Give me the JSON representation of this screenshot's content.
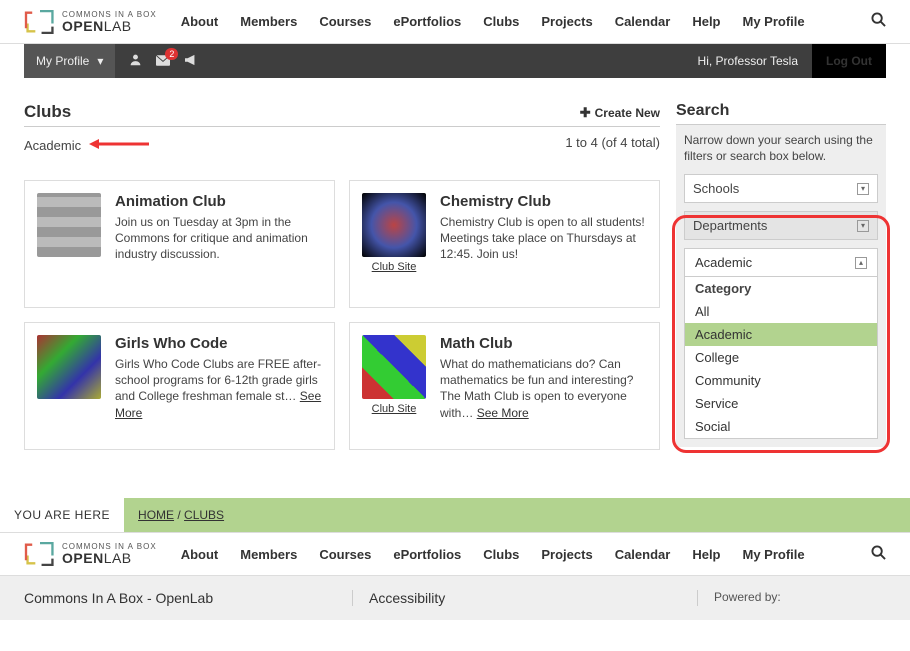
{
  "logo": {
    "line1": "COMMONS IN A BOX",
    "line2_bold": "OPEN",
    "line2_thin": "LAB"
  },
  "nav": [
    "About",
    "Members",
    "Courses",
    "ePortfolios",
    "Clubs",
    "Projects",
    "Calendar",
    "Help",
    "My Profile"
  ],
  "darkbar": {
    "my_profile": "My Profile",
    "notification_count": "2",
    "greeting": "Hi, Professor Tesla",
    "logout": "Log Out"
  },
  "page": {
    "title": "Clubs",
    "create_new": "Create New",
    "filter_label": "Academic",
    "count_text": "1 to 4 (of 4 total)"
  },
  "clubs": [
    {
      "title": "Animation Club",
      "desc": "Join us on Tuesday at 3pm in the Commons for critique and animation industry discussion.",
      "site": ""
    },
    {
      "title": "Chemistry Club",
      "desc": "Chemistry Club is open to all students! Meetings take place on Thursdays at 12:45. Join us!",
      "site": "Club Site"
    },
    {
      "title": "Girls Who Code",
      "desc": "Girls Who Code Clubs are FREE after-school programs for 6-12th grade girls and College freshman female st…",
      "seemore": "See More",
      "site": ""
    },
    {
      "title": "Math Club",
      "desc": "What do mathematicians do? Can mathematics be fun and interesting? The Math Club is open to everyone with…",
      "seemore": "See More",
      "site": "Club Site"
    }
  ],
  "search": {
    "heading": "Search",
    "help": "Narrow down your search using the filters or search box below.",
    "facets": [
      {
        "label": "Schools"
      },
      {
        "label": "Departments"
      }
    ],
    "open_filter": {
      "selected": "Academic",
      "header": "Category",
      "options": [
        "All",
        "Academic",
        "College",
        "Community",
        "Service",
        "Social"
      ]
    }
  },
  "breadcrumb": {
    "label": "YOU ARE HERE",
    "home": "HOME",
    "sep": " / ",
    "current": "CLUBS"
  },
  "footer": {
    "left": "Commons In A Box - OpenLab",
    "mid": "Accessibility",
    "right": "Powered by:"
  }
}
